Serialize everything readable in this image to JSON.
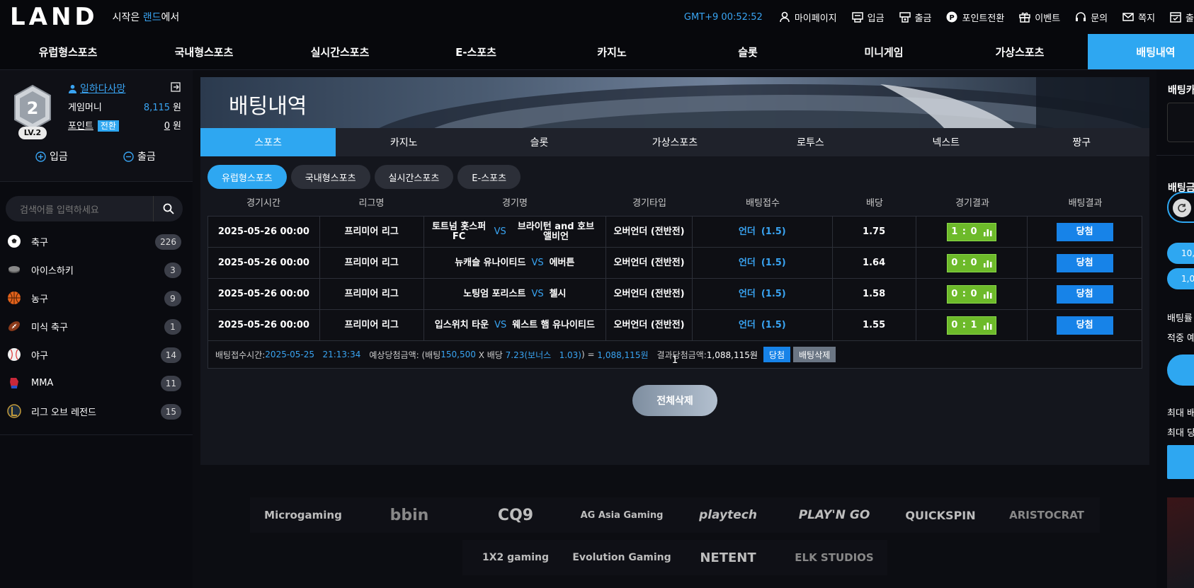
{
  "header": {
    "logo": "LAND",
    "slogan_pre": "시작은 ",
    "slogan_hl": "랜드",
    "slogan_post": "에서",
    "clock": "GMT+9 00:52:52",
    "links": [
      {
        "label": "마이페이지",
        "icon": "user-icon"
      },
      {
        "label": "입금",
        "icon": "deposit-icon"
      },
      {
        "label": "출금",
        "icon": "withdraw-icon"
      },
      {
        "label": "포인트전환",
        "icon": "point-icon"
      },
      {
        "label": "이벤트",
        "icon": "gift-icon"
      },
      {
        "label": "문의",
        "icon": "headset-icon"
      },
      {
        "label": "쪽지",
        "icon": "mail-icon"
      },
      {
        "label": "출",
        "icon": "calendar-icon"
      }
    ]
  },
  "nav": [
    {
      "label": "유럽형스포츠"
    },
    {
      "label": "국내형스포츠"
    },
    {
      "label": "실시간스포츠"
    },
    {
      "label": "E-스포츠"
    },
    {
      "label": "카지노"
    },
    {
      "label": "슬롯"
    },
    {
      "label": "미니게임"
    },
    {
      "label": "가상스포츠"
    },
    {
      "label": "배팅내역",
      "active": true
    }
  ],
  "profile": {
    "level_number": "2",
    "level_label": "LV.2",
    "username": "일하다사망",
    "money_label": "게임머니",
    "money_value": "8,115",
    "point_label": "포인트",
    "point_swap": "전환",
    "point_value": "0",
    "won": "원",
    "deposit": "입금",
    "withdraw": "출금"
  },
  "search": {
    "placeholder": "검색어를 입력하세요"
  },
  "sports": [
    {
      "name": "축구",
      "count": "226",
      "icon": "soccer-icon"
    },
    {
      "name": "아이스하키",
      "count": "3",
      "icon": "hockey-puck-icon"
    },
    {
      "name": "농구",
      "count": "9",
      "icon": "basketball-icon"
    },
    {
      "name": "미식 축구",
      "count": "1",
      "icon": "football-icon"
    },
    {
      "name": "야구",
      "count": "14",
      "icon": "baseball-icon"
    },
    {
      "name": "MMA",
      "count": "11",
      "icon": "mma-glove-icon"
    },
    {
      "name": "리그 오브 레전드",
      "count": "15",
      "icon": "lol-icon"
    }
  ],
  "page": {
    "banner_title": "배팅내역",
    "game_tabs": [
      "스포츠",
      "카지노",
      "슬롯",
      "가상스포츠",
      "로투스",
      "넥스트",
      "짱구"
    ],
    "sub_tabs": [
      "유럽형스포츠",
      "국내형스포츠",
      "실시간스포츠",
      "E-스포츠"
    ],
    "columns": [
      "경기시간",
      "리그명",
      "경기명",
      "경기타입",
      "배팅접수",
      "배당",
      "경기결과",
      "배팅결과"
    ],
    "rows": [
      {
        "time": "2025-05-26 00:00",
        "league": "프리미어 리그",
        "home": "토트넘 홋스퍼 FC",
        "vs": "VS",
        "away": "브라이턴 and 호브 앨비언",
        "type": "오버언더 (전반전)",
        "pick": "언더",
        "pick_line": "(1.5)",
        "odds": "1.75",
        "score": "1 : 0",
        "result": "당첨"
      },
      {
        "time": "2025-05-26 00:00",
        "league": "프리미어 리그",
        "home": "뉴캐슬 유나이티드",
        "vs": "VS",
        "away": "에버튼",
        "type": "오버언더 (전반전)",
        "pick": "언더",
        "pick_line": "(1.5)",
        "odds": "1.64",
        "score": "0 : 0",
        "result": "당첨"
      },
      {
        "time": "2025-05-26 00:00",
        "league": "프리미어 리그",
        "home": "노팅엄 포리스트",
        "vs": "VS",
        "away": "첼시",
        "type": "오버언더 (전반전)",
        "pick": "언더",
        "pick_line": "(1.5)",
        "odds": "1.58",
        "score": "0 : 0",
        "result": "당첨"
      },
      {
        "time": "2025-05-26 00:00",
        "league": "프리미어 리그",
        "home": "입스위치 타운",
        "vs": "VS",
        "away": "웨스트 햄 유나이티드",
        "type": "오버언더 (전반전)",
        "pick": "언더",
        "pick_line": "(1.5)",
        "odds": "1.55",
        "score": "0 : 1",
        "result": "당첨"
      }
    ],
    "summary": {
      "label1": "배팅접수시간: ",
      "time": "2025-05-25   21:13:34",
      "label2": "예상당첨금액: (배팅 ",
      "bet": "150,500",
      "x": " X 배당 ",
      "odds": "7.23(보너스   1.03)",
      "eq": ") = ",
      "expected": "1,088,115원",
      "label3": "결과당첨금액: ",
      "result": "1,088,115원",
      "btn_win": "당첨",
      "btn_delete": "배팅삭제"
    },
    "pagination": "1",
    "delete_all": "전체삭제"
  },
  "providers_row1": [
    "Microgaming",
    "bbin",
    "CQ9",
    "AG Asia Gaming",
    "playtech",
    "PLAY'N GO",
    "QUICKSPIN",
    "ARISTOCRAT"
  ],
  "providers_row2": [
    "1X2 gaming",
    "Evolution Gaming",
    "NETENT",
    "ELK STUDIOS"
  ],
  "right": {
    "title": "배팅카",
    "amount_title": "배팅금",
    "pill1": "10,",
    "pill2": "1,00",
    "txt1": "배팅률",
    "txt2": "적중 예",
    "txt3": "최대 배",
    "txt4": "최대 당"
  },
  "colors": {
    "accent": "#2ea7f1",
    "win_blue": "#1783e8",
    "score_green": "#6dba2a",
    "bg": "#0c0d12"
  }
}
